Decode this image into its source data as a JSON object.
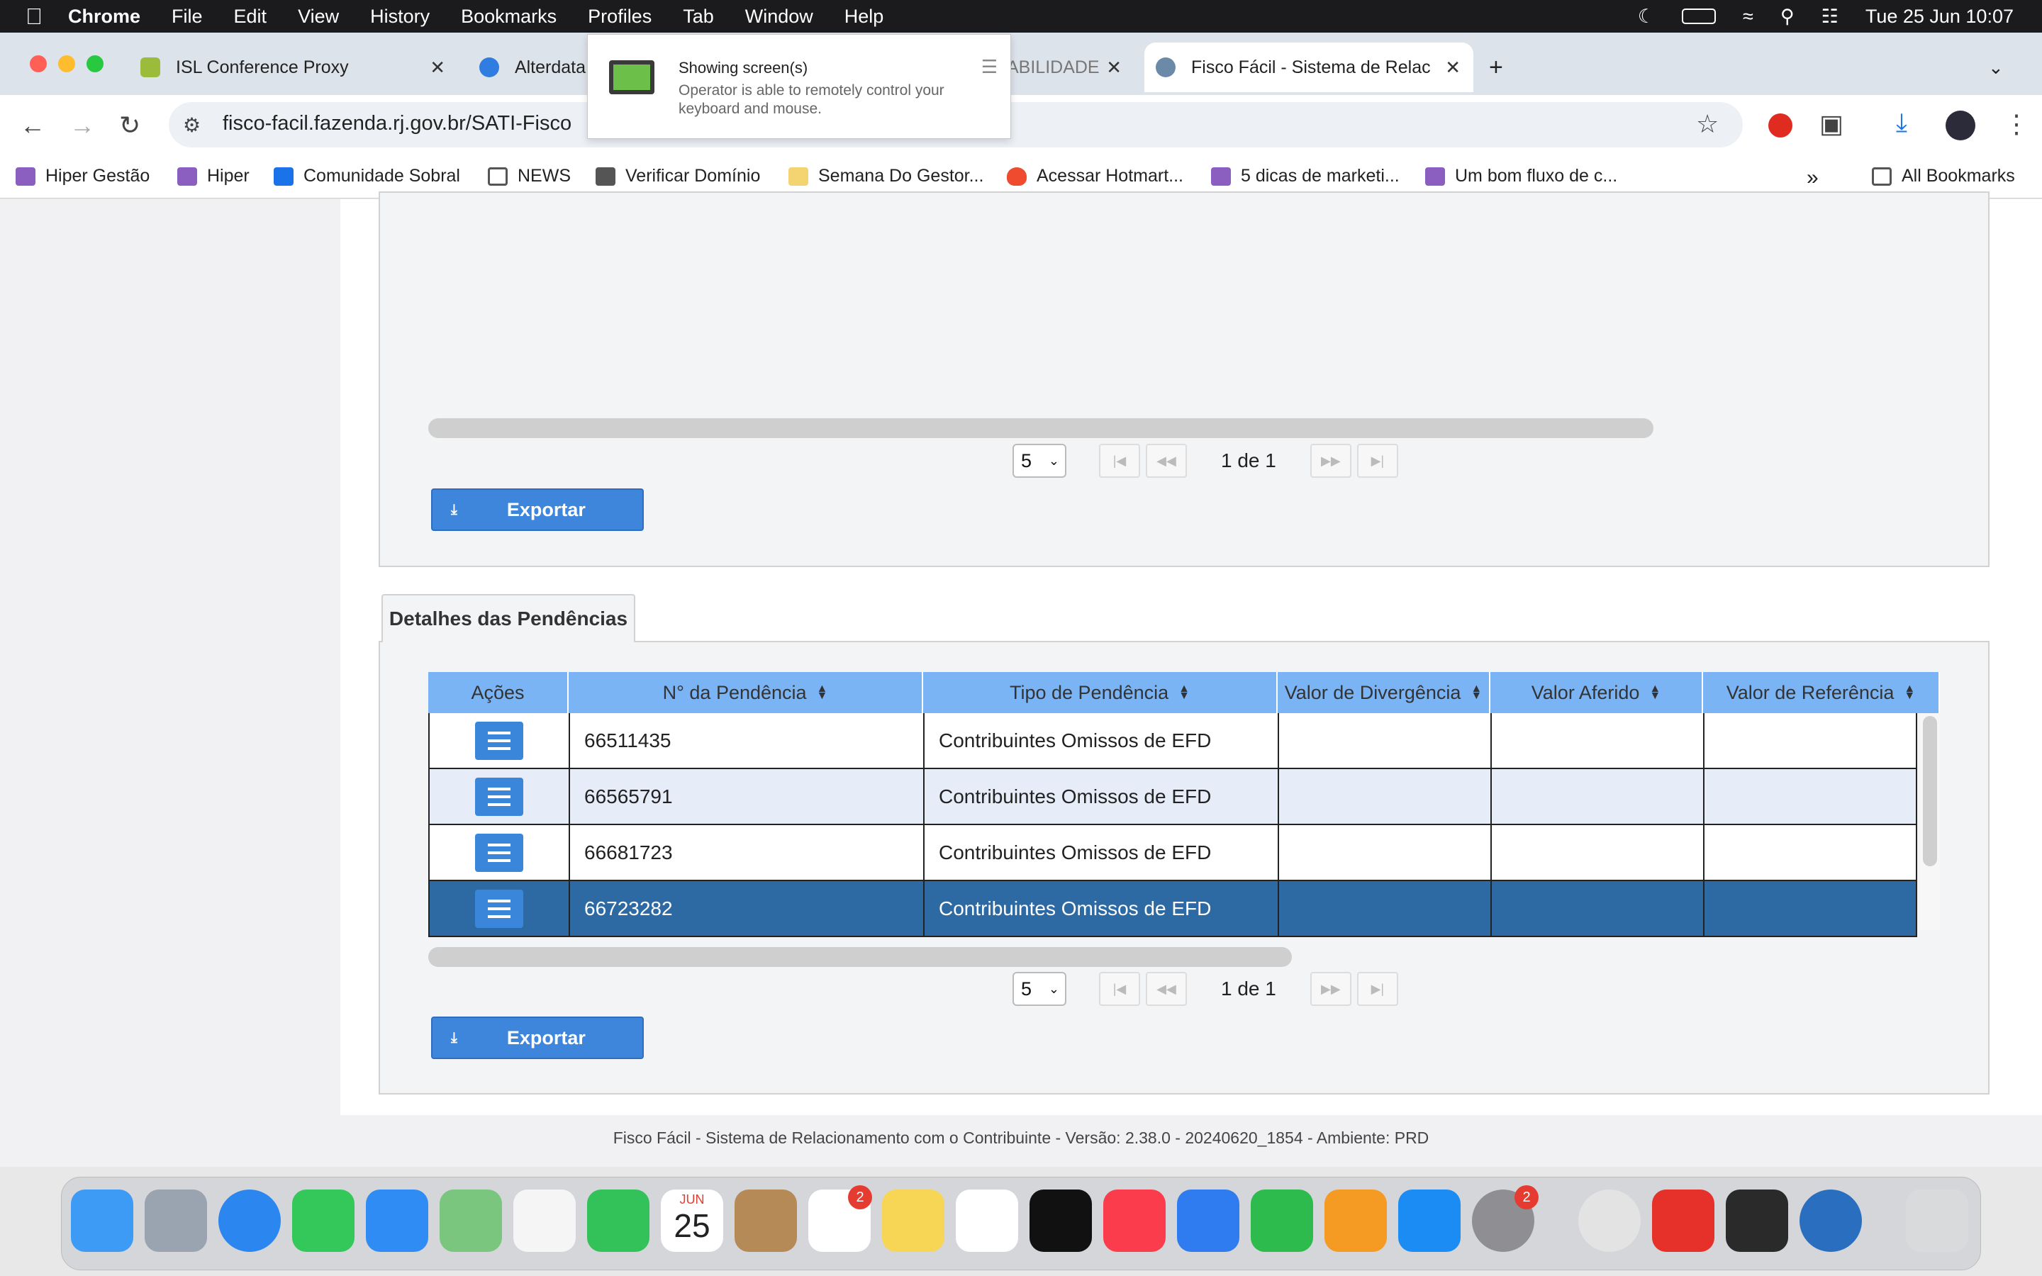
{
  "menubar": {
    "app": "Chrome",
    "items": [
      "File",
      "Edit",
      "View",
      "History",
      "Bookmarks",
      "Profiles",
      "Tab",
      "Window",
      "Help"
    ],
    "datetime": "Tue 25 Jun  10:07"
  },
  "tabs": [
    {
      "title": "ISL Conference Proxy"
    },
    {
      "title": "Alterdata"
    },
    {
      "title": "ABILIDADE"
    },
    {
      "title": "Fisco Fácil - Sistema de Relac"
    }
  ],
  "address": {
    "url": "fisco-facil.fazenda.rj.gov.br/SATI-Fisco"
  },
  "bookmarks": {
    "items": [
      "Hiper Gestão",
      "Hiper",
      "Comunidade Sobral",
      "NEWS",
      "Verificar Domínio",
      "Semana Do Gestor...",
      "Acessar Hotmart...",
      "5 dicas de marketi...",
      "Um bom fluxo de c..."
    ],
    "all_label": "All Bookmarks"
  },
  "popup": {
    "title": "Showing screen(s)",
    "description": "Operator is able to remotely control your keyboard and mouse."
  },
  "top_panel": {
    "page_size": "5",
    "page_info": "1 de 1",
    "export_label": "Exportar"
  },
  "details": {
    "tab_label": "Detalhes das Pendências",
    "columns": [
      "Ações",
      "N° da Pendência",
      "Tipo de Pendência",
      "Valor de Divergência",
      "Valor Aferido",
      "Valor de Referência"
    ],
    "rows": [
      {
        "numero": "66511435",
        "tipo": "Contribuintes Omissos de EFD",
        "divergencia": "",
        "aferido": "",
        "referencia": ""
      },
      {
        "numero": "66565791",
        "tipo": "Contribuintes Omissos de EFD",
        "divergencia": "",
        "aferido": "",
        "referencia": ""
      },
      {
        "numero": "66681723",
        "tipo": "Contribuintes Omissos de EFD",
        "divergencia": "",
        "aferido": "",
        "referencia": ""
      },
      {
        "numero": "66723282",
        "tipo": "Contribuintes Omissos de EFD",
        "divergencia": "",
        "aferido": "",
        "referencia": ""
      }
    ],
    "page_size": "5",
    "page_info": "1 de 1",
    "export_label": "Exportar"
  },
  "footer": {
    "text": "Fisco Fácil - Sistema de Relacionamento com o Contribuinte - Versão: 2.38.0 - 20240620_1854 - Ambiente: PRD"
  },
  "dock": {
    "calendar_month": "JUN",
    "calendar_day": "25",
    "reminders_badge": "2",
    "settings_badge": "2"
  }
}
